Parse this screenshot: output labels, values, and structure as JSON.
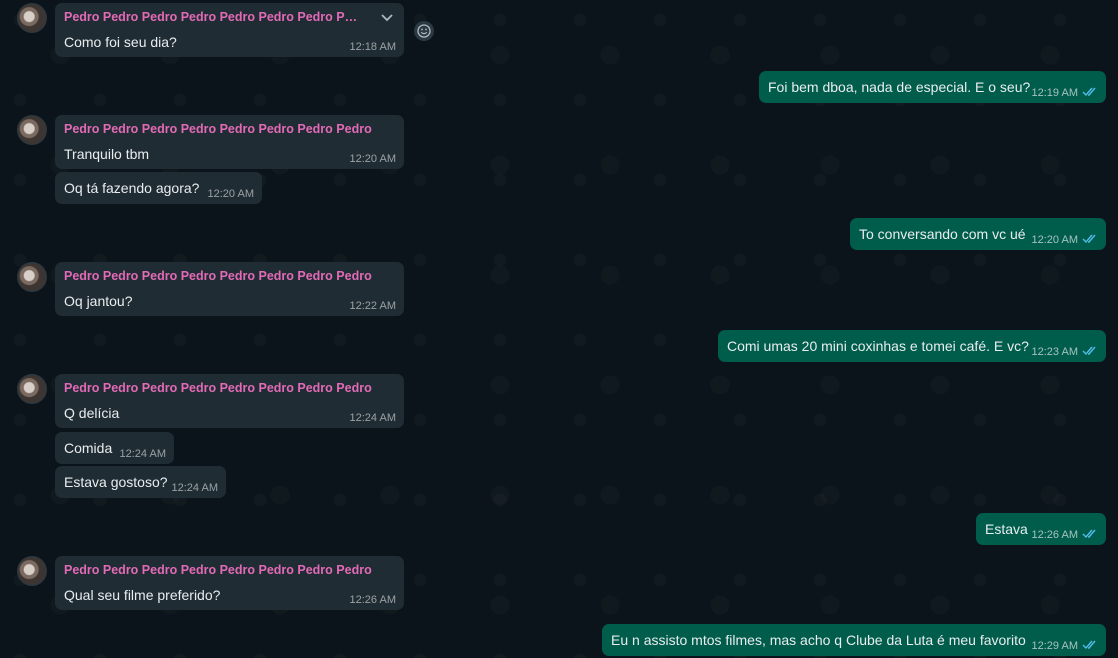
{
  "chat": {
    "sender_name_truncated": "Pedro Pedro Pedro Pedro Pedro Pedro Pedro Pedro",
    "sender_name": "Pedro Pedro Pedro Pedro Pedro Pedro Pedro Pedro",
    "messages": [
      {
        "text": "Como foi seu dia?",
        "time": "12:18 AM"
      },
      {
        "text": "Foi bem dboa, nada de especial. E o seu?",
        "time": "12:19 AM"
      },
      {
        "text": "Tranquilo tbm",
        "time": "12:20 AM"
      },
      {
        "text": "Oq tá fazendo agora?",
        "time": "12:20 AM"
      },
      {
        "text": "To conversando com vc ué",
        "time": "12:20 AM"
      },
      {
        "text": "Oq jantou?",
        "time": "12:22 AM"
      },
      {
        "text": "Comi umas 20 mini coxinhas e tomei café. E vc?",
        "time": "12:23 AM"
      },
      {
        "text": "Q delícia",
        "time": "12:24 AM"
      },
      {
        "text": "Comida",
        "time": "12:24 AM"
      },
      {
        "text": "Estava gostoso?",
        "time": "12:24 AM"
      },
      {
        "text": "Estava",
        "time": "12:26 AM"
      },
      {
        "text": "Qual seu filme preferido?",
        "time": "12:26 AM"
      },
      {
        "text": "Eu n assisto mtos filmes, mas acho q Clube da Luta é meu favorito",
        "time": "12:29 AM"
      }
    ]
  },
  "colors": {
    "background": "#0b141a",
    "incoming_bubble": "#202c33",
    "outgoing_bubble": "#005c4b",
    "sender_name": "#e26ab6",
    "read_ticks": "#53bdeb"
  },
  "icons": {
    "menu_chevron": "chevron-down-icon",
    "react": "emoji-icon",
    "read_receipt": "double-check-icon"
  }
}
